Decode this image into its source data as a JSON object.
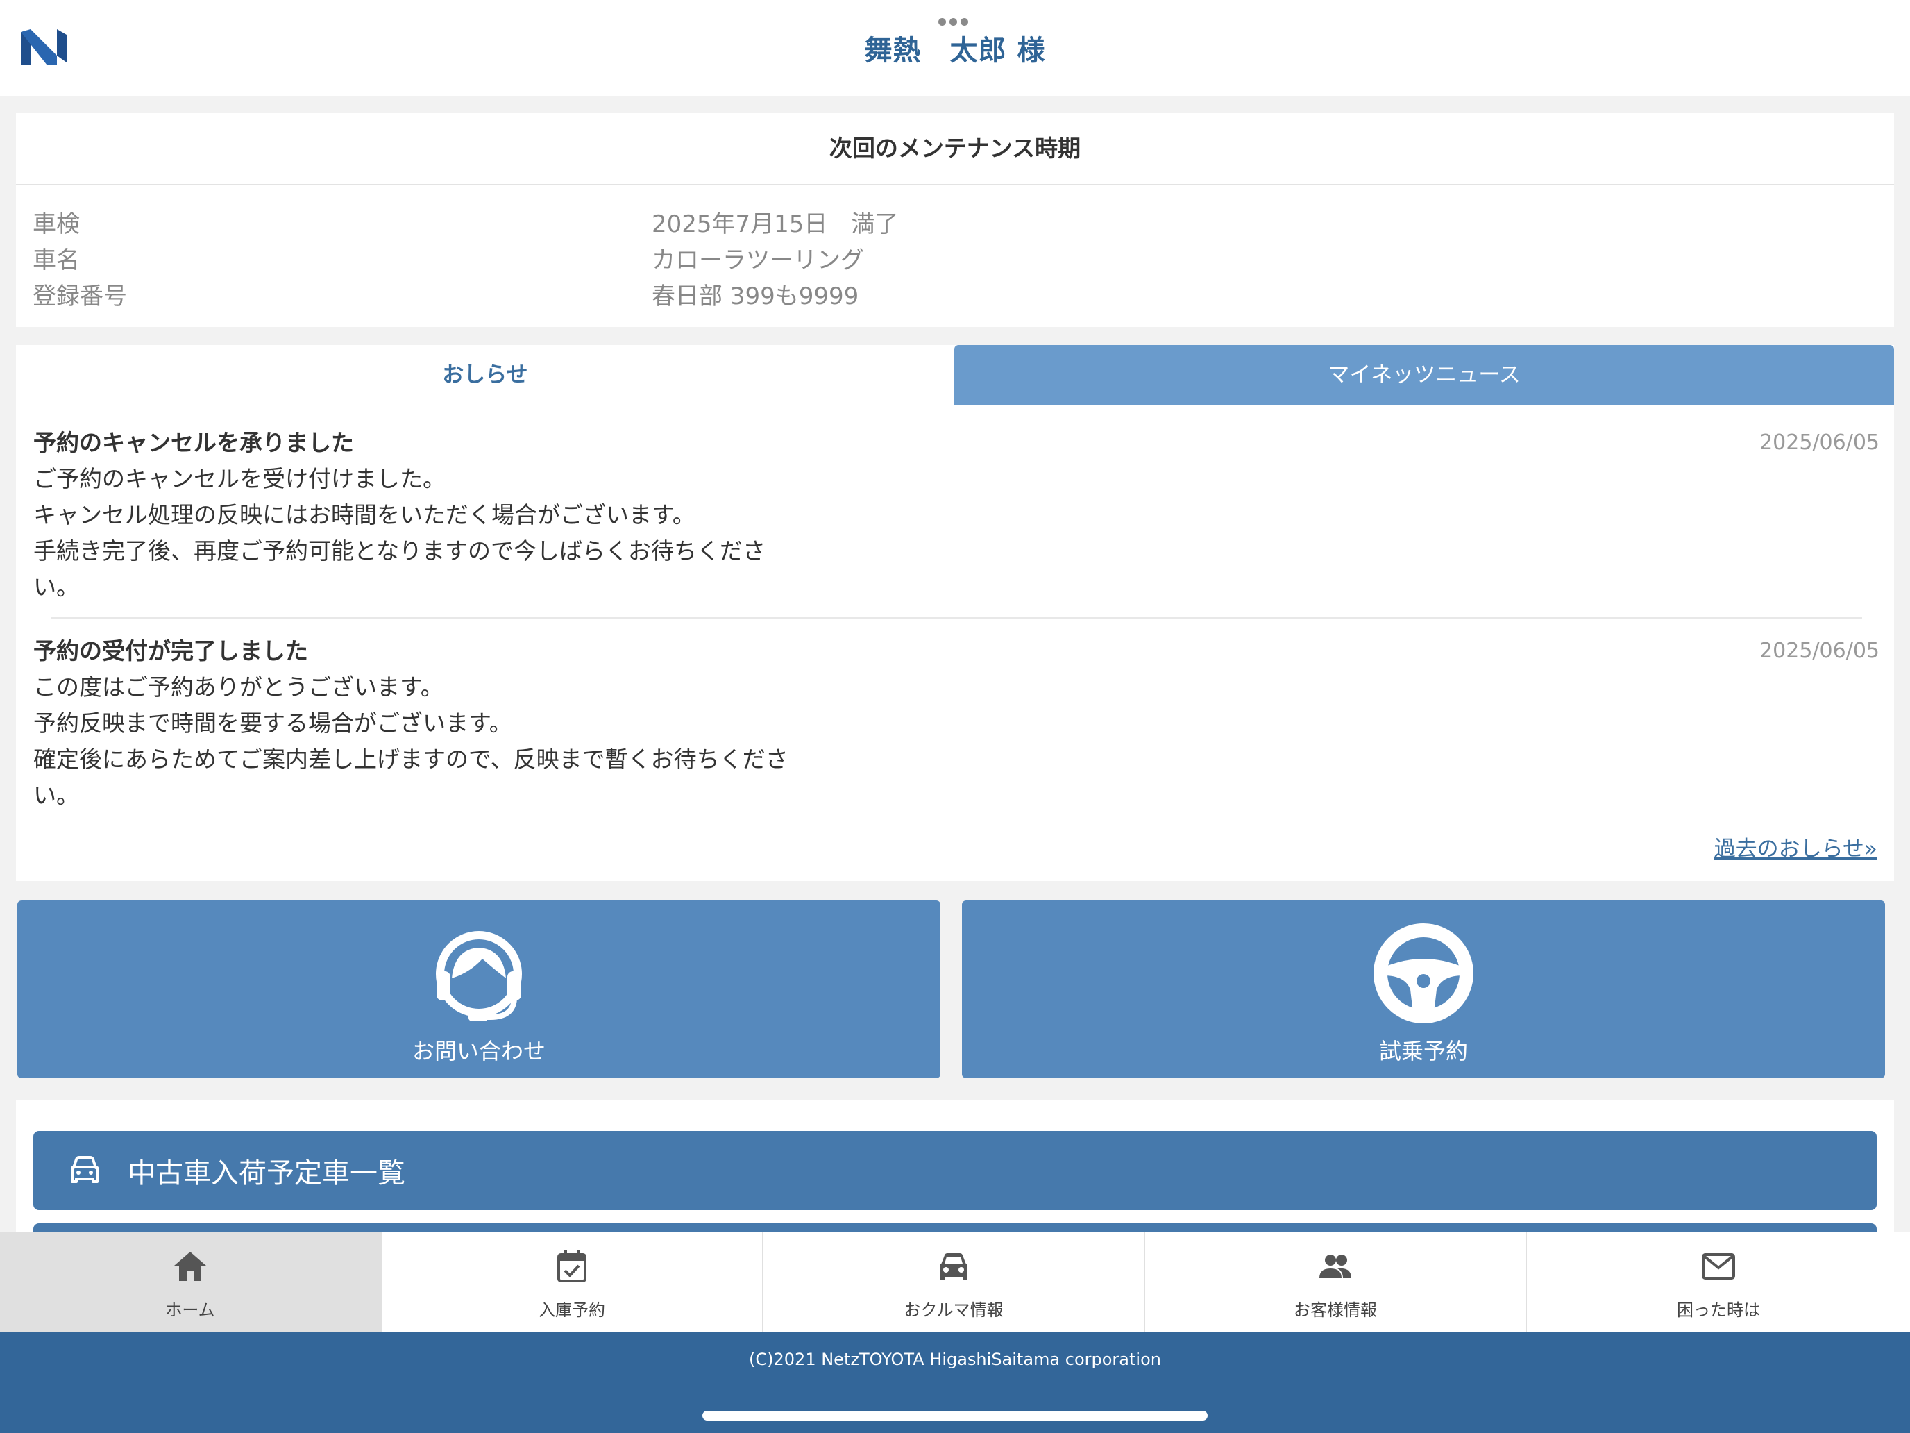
{
  "header": {
    "user_name": "舞熱　太郎 様",
    "accent_color": "#2f6496",
    "logo_icon": "netz-logo-icon"
  },
  "maintenance": {
    "title": "次回のメンテナンス時期",
    "rows": [
      {
        "label": "車検",
        "value": "2025年7月15日　満了"
      },
      {
        "label": "車名",
        "value": "カローラツーリング"
      },
      {
        "label": "登録番号",
        "value": "春日部 399も9999"
      }
    ]
  },
  "tabs": {
    "active": "おしらせ",
    "inactive": "マイネッツニュース",
    "inactive_color": "#6a9bcc"
  },
  "news": {
    "items": [
      {
        "title": "予約のキャンセルを承りました",
        "date": "2025/06/05",
        "lines": [
          "ご予約のキャンセルを受け付けました。",
          "キャンセル処理の反映にはお時間をいただく場合がございます。",
          "手続き完了後、再度ご予約可能となりますので今しばらくお待ちくださ",
          "い。"
        ]
      },
      {
        "title": "予約の受付が完了しました",
        "date": "2025/06/05",
        "lines": [
          "この度はご予約ありがとうございます。",
          "予約反映まで時間を要する場合がございます。",
          "確定後にあらためてご案内差し上げますので、反映まで暫くお待ちくださ",
          "い。"
        ]
      }
    ],
    "past_link": "過去のおしらせ»"
  },
  "actions": {
    "contact_label": "お問い合わせ",
    "contact_icon": "headset-operator-icon",
    "test_drive_label": "試乗予約",
    "test_drive_icon": "steering-wheel-icon",
    "button_color": "#5689bd"
  },
  "used_cars": {
    "label": "中古車入荷予定車一覧",
    "icon": "car-icon"
  },
  "bottom_nav": [
    {
      "label": "ホーム",
      "icon": "home-icon"
    },
    {
      "label": "入庫予約",
      "icon": "calendar-check-icon"
    },
    {
      "label": "おクルマ情報",
      "icon": "car-icon"
    },
    {
      "label": "お客様情報",
      "icon": "people-icon"
    },
    {
      "label": "困った時は",
      "icon": "mail-icon"
    }
  ],
  "footer": {
    "copyright": "(C)2021 NetzTOYOTA HigashiSaitama corporation",
    "color": "#336699"
  }
}
